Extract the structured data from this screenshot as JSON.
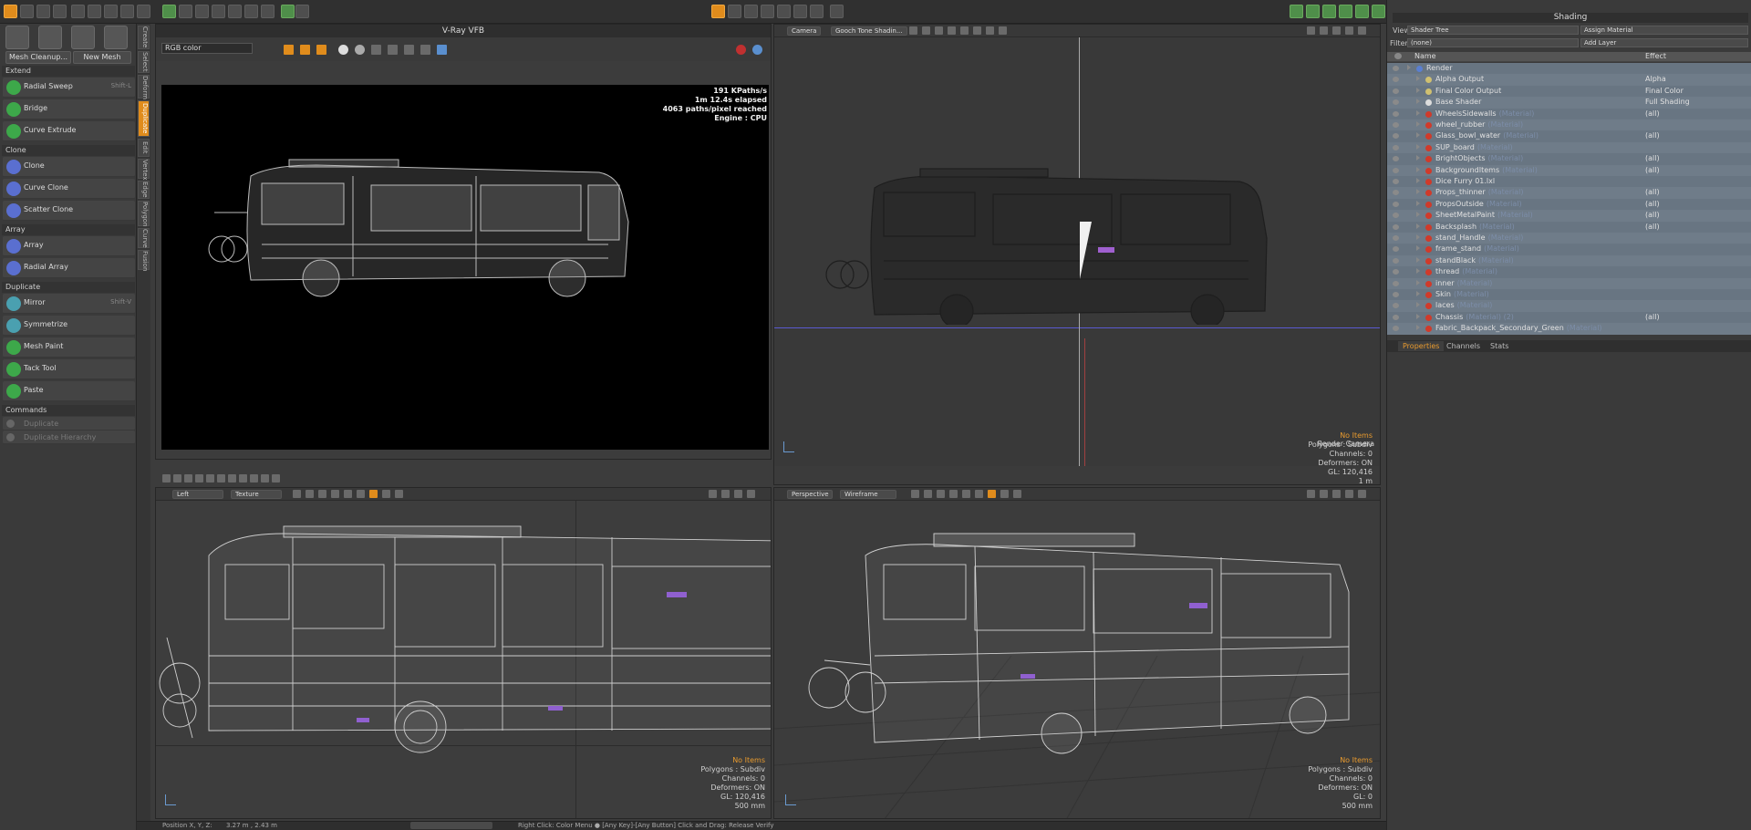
{
  "left_panel": {
    "top_buttons": {
      "mesh_cleanup": "Mesh Cleanup...",
      "new_mesh": "New Mesh"
    },
    "sections": [
      {
        "title": "Extend",
        "items": [
          {
            "label": "Radial Sweep",
            "key": "Shift-L",
            "icon": "radial-sweep-icon"
          },
          {
            "label": "Bridge",
            "key": "",
            "icon": "bridge-icon"
          },
          {
            "label": "Curve Extrude",
            "key": "",
            "icon": "curve-extrude-icon"
          }
        ]
      },
      {
        "title": "Clone",
        "items": [
          {
            "label": "Clone",
            "key": "",
            "icon": "clone-icon"
          },
          {
            "label": "Curve Clone",
            "key": "",
            "icon": "curve-clone-icon"
          },
          {
            "label": "Scatter Clone",
            "key": "",
            "icon": "scatter-clone-icon"
          }
        ]
      },
      {
        "title": "Array",
        "items": [
          {
            "label": "Array",
            "key": "",
            "icon": "array-icon"
          },
          {
            "label": "Radial Array",
            "key": "",
            "icon": "radial-array-icon"
          }
        ]
      },
      {
        "title": "Duplicate",
        "items": [
          {
            "label": "Mirror",
            "key": "Shift-V",
            "icon": "mirror-icon"
          },
          {
            "label": "Symmetrize",
            "key": "",
            "icon": "symmetrize-icon"
          },
          {
            "label": "Mesh Paint",
            "key": "",
            "icon": "mesh-paint-icon"
          },
          {
            "label": "Tack Tool",
            "key": "",
            "icon": "tack-tool-icon"
          },
          {
            "label": "Paste",
            "key": "",
            "icon": "paste-icon"
          }
        ]
      },
      {
        "title": "Commands",
        "items": [
          {
            "label": "Duplicate",
            "key": "",
            "icon": "duplicate-icon",
            "disabled": true
          },
          {
            "label": "Duplicate Hierarchy",
            "key": "",
            "icon": "duplicate-hierarchy-icon",
            "disabled": true
          }
        ]
      }
    ],
    "vertical_tabs": [
      "Create",
      "Select",
      "Deform",
      "Duplicate",
      "Edit",
      "Vertex",
      "Edge",
      "Polygon",
      "Curve",
      "Fusion"
    ]
  },
  "vfb": {
    "title": "V-Ray VFB",
    "channel": "RGB color",
    "stats": [
      "191 KPaths/s",
      "1m 12.4s elapsed",
      "4063 paths/pixel reached",
      "Engine : CPU"
    ]
  },
  "camera_view": {
    "tabs": [
      "Camera",
      "Gooch Tone Shadin..."
    ],
    "label": "Render Camera",
    "info": {
      "no_items": "No Items",
      "polygons": "Polygons : Subdiv",
      "channels": "Channels: 0",
      "deformers": "Deformers: ON",
      "gl": "GL: 120,416",
      "scale": "1 m"
    }
  },
  "left_view": {
    "tabs": [
      "Left",
      "Texture"
    ],
    "info": {
      "no_items": "No Items",
      "polygons": "Polygons : Subdiv",
      "channels": "Channels: 0",
      "deformers": "Deformers: ON",
      "gl": "GL: 120,416",
      "scale": "500 mm"
    }
  },
  "persp_view": {
    "tabs": [
      "Perspective",
      "Wireframe"
    ],
    "info": {
      "no_items": "No Items",
      "polygons": "Polygons : Subdiv",
      "channels": "Channels: 0",
      "deformers": "Deformers: ON",
      "gl": "GL: 0",
      "scale": "500 mm"
    }
  },
  "shading": {
    "title": "Shading",
    "view_label": "View",
    "view_value": "Shader Tree",
    "assign": "Assign Material",
    "filter_label": "Filter",
    "filter_value": "(none)",
    "add_layer": "Add Layer",
    "col_name": "Name",
    "col_effect": "Effect",
    "rows": [
      {
        "name": "Render",
        "type": "",
        "effect": "",
        "indent": 0,
        "icon": "render"
      },
      {
        "name": "Alpha Output",
        "type": "",
        "effect": "Alpha",
        "indent": 1,
        "icon": "output"
      },
      {
        "name": "Final Color Output",
        "type": "",
        "effect": "Final Color",
        "indent": 1,
        "icon": "output"
      },
      {
        "name": "Base Shader",
        "type": "",
        "effect": "Full Shading",
        "indent": 1,
        "icon": "shader"
      },
      {
        "name": "WheelsSidewalls",
        "type": "(Material)",
        "effect": "(all)",
        "indent": 1,
        "icon": "mat"
      },
      {
        "name": "wheel_rubber",
        "type": "(Material)",
        "effect": "",
        "indent": 1,
        "icon": "mat"
      },
      {
        "name": "Glass_bowl_water",
        "type": "(Material)",
        "effect": "(all)",
        "indent": 1,
        "icon": "mat"
      },
      {
        "name": "SUP_board",
        "type": "(Material)",
        "effect": "",
        "indent": 1,
        "icon": "mat"
      },
      {
        "name": "BrightObjects",
        "type": "(Material)",
        "effect": "(all)",
        "indent": 1,
        "icon": "mat"
      },
      {
        "name": "BackgroundItems",
        "type": "(Material)",
        "effect": "(all)",
        "indent": 1,
        "icon": "mat"
      },
      {
        "name": "Dice Furry 01.lxl",
        "type": "",
        "effect": "",
        "indent": 1,
        "icon": "mat"
      },
      {
        "name": "Props_thinner",
        "type": "(Material)",
        "effect": "(all)",
        "indent": 1,
        "icon": "mat"
      },
      {
        "name": "PropsOutside",
        "type": "(Material)",
        "effect": "(all)",
        "indent": 1,
        "icon": "mat"
      },
      {
        "name": "SheetMetalPaint",
        "type": "(Material)",
        "effect": "(all)",
        "indent": 1,
        "icon": "mat"
      },
      {
        "name": "Backsplash",
        "type": "(Material)",
        "effect": "(all)",
        "indent": 1,
        "icon": "mat"
      },
      {
        "name": "stand_Handle",
        "type": "(Material)",
        "effect": "",
        "indent": 1,
        "icon": "mat"
      },
      {
        "name": "frame_stand",
        "type": "(Material)",
        "effect": "",
        "indent": 1,
        "icon": "mat"
      },
      {
        "name": "standBlack",
        "type": "(Material)",
        "effect": "",
        "indent": 1,
        "icon": "mat"
      },
      {
        "name": "thread",
        "type": "(Material)",
        "effect": "",
        "indent": 1,
        "icon": "mat"
      },
      {
        "name": "inner",
        "type": "(Material)",
        "effect": "",
        "indent": 1,
        "icon": "mat"
      },
      {
        "name": "Skin",
        "type": "(Material)",
        "effect": "",
        "indent": 1,
        "icon": "mat"
      },
      {
        "name": "laces",
        "type": "(Material)",
        "effect": "",
        "indent": 1,
        "icon": "mat"
      },
      {
        "name": "Chassis",
        "type": "(Material) (2)",
        "effect": "(all)",
        "indent": 1,
        "icon": "mat"
      },
      {
        "name": "Fabric_Backpack_Secondary_Green",
        "type": "(Material)",
        "effect": "",
        "indent": 1,
        "icon": "mat"
      }
    ],
    "tabs": [
      "Properties",
      "Channels",
      "Stats"
    ]
  },
  "statusbar": {
    "position": "Position X, Y, Z:",
    "pos_values": "3.27 m , 2.43 m",
    "hint": "Right Click: Color Menu ● [Any Key]-[Any Button] Click and Drag: Release Verify"
  },
  "colors": {
    "accent": "#e08c1c",
    "vp_bg": "#3e3e3e",
    "vfb_bg": "#000000",
    "panel": "#3a3a3a"
  }
}
